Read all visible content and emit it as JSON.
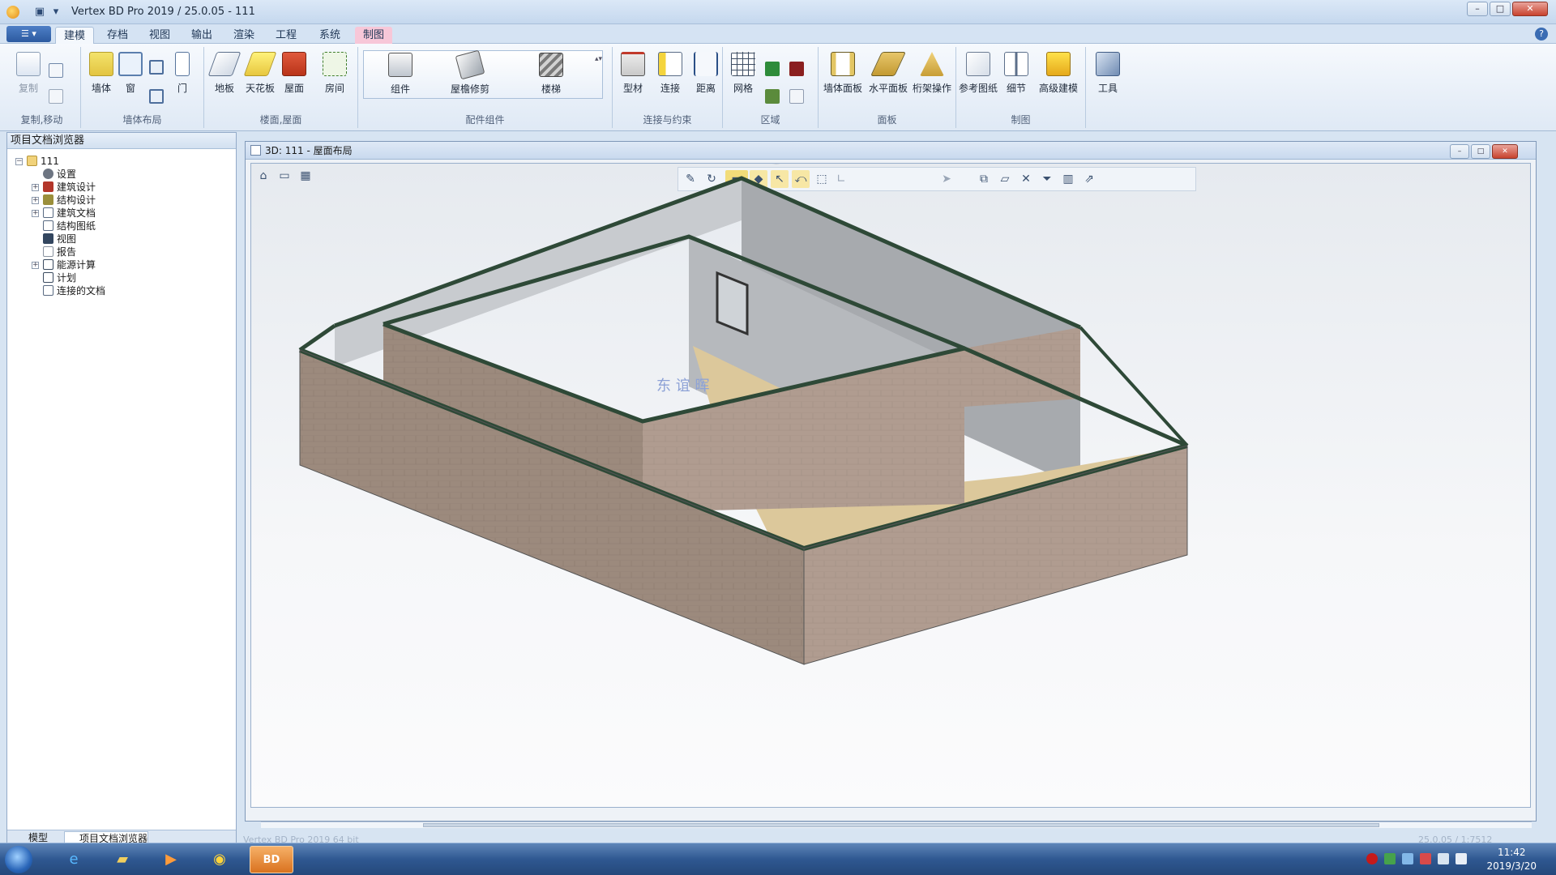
{
  "titlebar": {
    "title": "Vertex BD Pro 2019 / 25.0.05 - 111",
    "min": "–",
    "max": "□",
    "close": "✕"
  },
  "tabs": [
    {
      "label": "建模"
    },
    {
      "label": "存档"
    },
    {
      "label": "视图"
    },
    {
      "label": "输出"
    },
    {
      "label": "渲染"
    },
    {
      "label": "工程"
    },
    {
      "label": "系统"
    },
    {
      "label": "制图"
    }
  ],
  "ribbon": {
    "groups": {
      "copy_move": "复制,移动",
      "wall_layout": "墙体布局",
      "floor_roof": "楼面,屋面",
      "components": "配件组件",
      "connect": "连接与约束",
      "area": "区域",
      "panel": "面板",
      "drawing": "制图"
    },
    "buttons": {
      "copy": "复制",
      "wall": "墙体",
      "window": "窗",
      "door": "门",
      "floor": "地板",
      "ceiling": "天花板",
      "roof": "屋面",
      "room": "房间",
      "component": "组件",
      "eave_trim": "屋檐修剪",
      "stair": "楼梯",
      "profile": "型材",
      "connect": "连接",
      "distance": "距离",
      "grid": "网格",
      "wall_panel": "墙体面板",
      "horiz_panel": "水平面板",
      "truss_op": "桁架操作",
      "ref_drawing": "参考图纸",
      "detail": "细节",
      "adv_model": "高级建模",
      "tools": "工具"
    }
  },
  "browser": {
    "title": "项目文档浏览器",
    "root": "111",
    "items": [
      {
        "label": "设置"
      },
      {
        "label": "建筑设计"
      },
      {
        "label": "结构设计"
      },
      {
        "label": "建筑文档"
      },
      {
        "label": "结构图纸"
      },
      {
        "label": "视图"
      },
      {
        "label": "报告"
      },
      {
        "label": "能源计算"
      },
      {
        "label": "计划"
      },
      {
        "label": "连接的文档"
      }
    ],
    "bottom_tabs": [
      "模型",
      "项目文档浏览器"
    ]
  },
  "view": {
    "title": "3D: 111 - 屋面布局",
    "watermark": "东 谊 晖"
  },
  "status": {
    "left": "Vertex BD Pro 2019 64 bit",
    "right": "25.0.05 / 1:7512"
  },
  "taskbar": {
    "active_app": "BD",
    "time": "11:42",
    "date": "2019/3/20"
  },
  "colors": {
    "wall_exterior": "#9b8679",
    "wall_top_trim": "#2f4a36",
    "floor": "#dcc89b",
    "wall_interior": "#a6a9ad"
  }
}
